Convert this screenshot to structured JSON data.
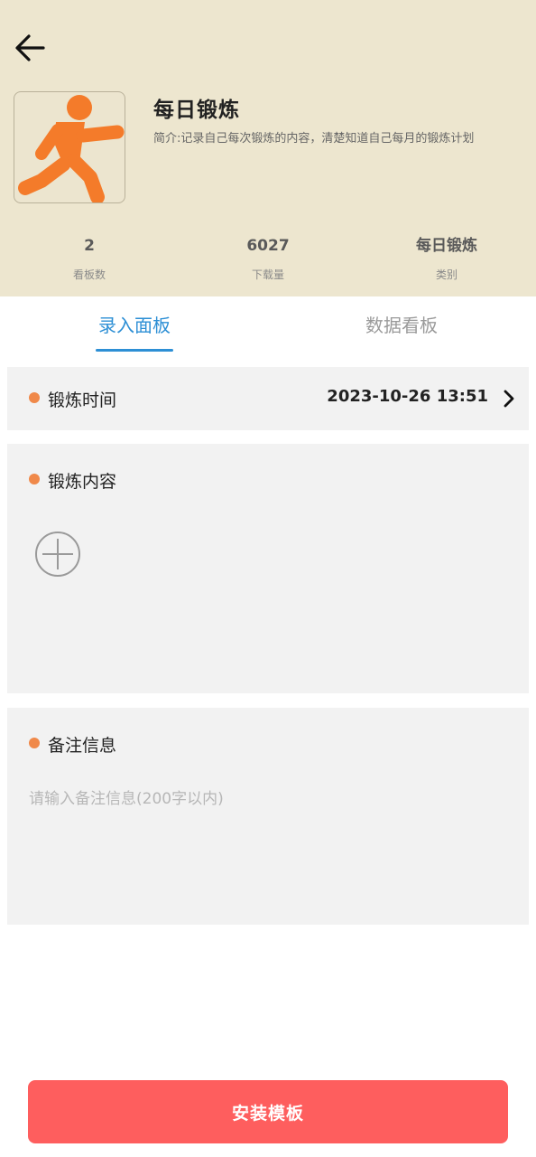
{
  "header": {
    "back_icon": "arrow-left-icon",
    "app_icon": "running-person-icon",
    "title": "每日锻炼",
    "description": "简介:记录自己每次锻炼的内容，清楚知道自己每月的锻炼计划",
    "stats": [
      {
        "value": "2",
        "label": "看板数"
      },
      {
        "value": "6027",
        "label": "下载量"
      },
      {
        "value": "每日锻炼",
        "label": "类别"
      }
    ],
    "icon_color": "#f47b2a",
    "background_color": "#ede6cf"
  },
  "tabs": [
    {
      "label": "录入面板",
      "active": true
    },
    {
      "label": "数据看板",
      "active": false
    }
  ],
  "form": {
    "time_field": {
      "label": "锻炼时间",
      "value": "2023-10-26 13:51",
      "icon": "chevron-right-icon"
    },
    "content_field": {
      "label": "锻炼内容",
      "add_icon": "plus-circle-icon"
    },
    "notes_field": {
      "label": "备注信息",
      "placeholder": "请输入备注信息(200字以内)",
      "value": ""
    }
  },
  "install_button": {
    "label": "安装模板",
    "color": "#fe5e5e"
  },
  "accent_color": "#2d8fd5",
  "dot_color": "#f0894a"
}
